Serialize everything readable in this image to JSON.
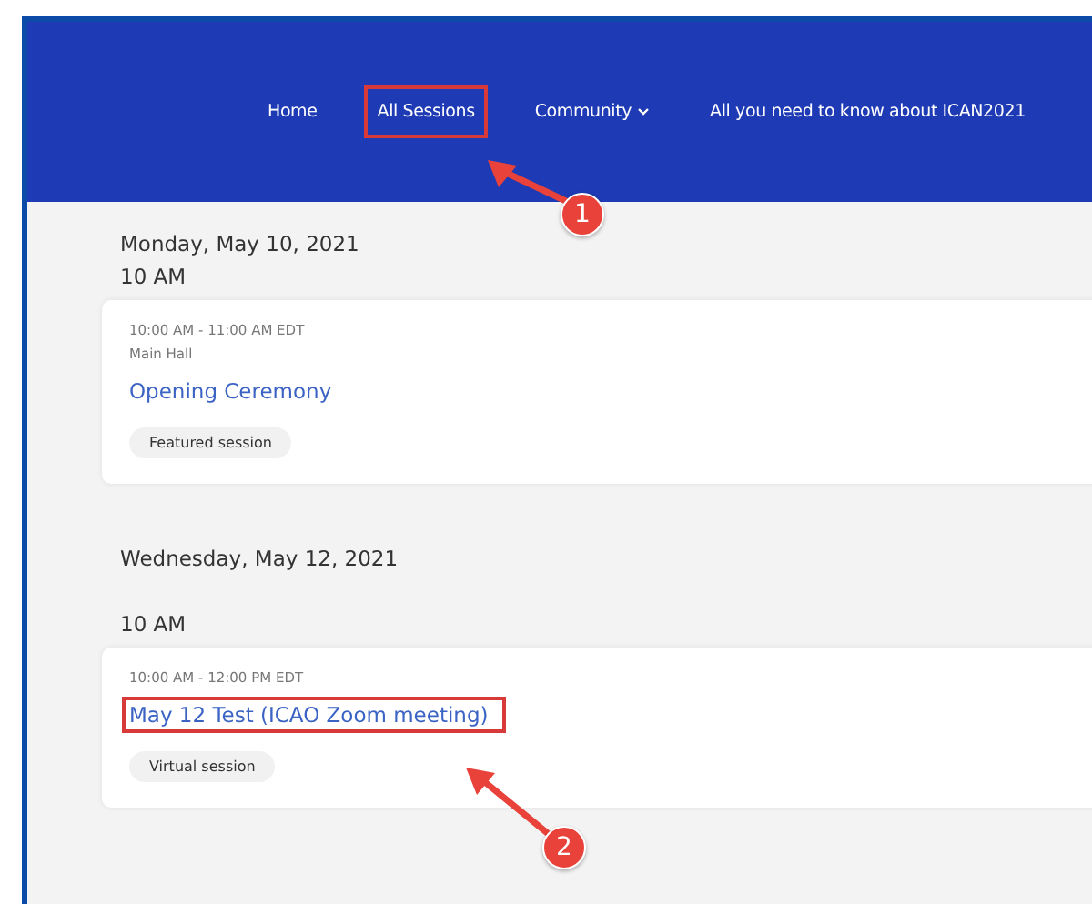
{
  "nav": {
    "items": [
      {
        "label": "Home",
        "highlighted": false,
        "dropdown": false
      },
      {
        "label": "All Sessions",
        "highlighted": true,
        "dropdown": false
      },
      {
        "label": "Community",
        "highlighted": false,
        "dropdown": true
      },
      {
        "label": "All you need to know about ICAN2021",
        "highlighted": false,
        "dropdown": false
      }
    ]
  },
  "days": [
    {
      "date": "Monday, May 10, 2021",
      "slots": [
        {
          "time": "10 AM",
          "sessions": [
            {
              "hours": "10:00 AM - 11:00 AM EDT",
              "location": "Main Hall",
              "title": "Opening Ceremony",
              "highlighted": false,
              "tag": "Featured session"
            }
          ]
        }
      ]
    },
    {
      "date": "Wednesday, May 12, 2021",
      "slots": [
        {
          "time": "10 AM",
          "sessions": [
            {
              "hours": "10:00 AM - 12:00 PM EDT",
              "title": "May 12 Test (ICAO Zoom meeting)",
              "highlighted": true,
              "tag": "Virtual session"
            }
          ]
        }
      ]
    }
  ],
  "callouts": [
    {
      "number": "1"
    },
    {
      "number": "2"
    }
  ]
}
